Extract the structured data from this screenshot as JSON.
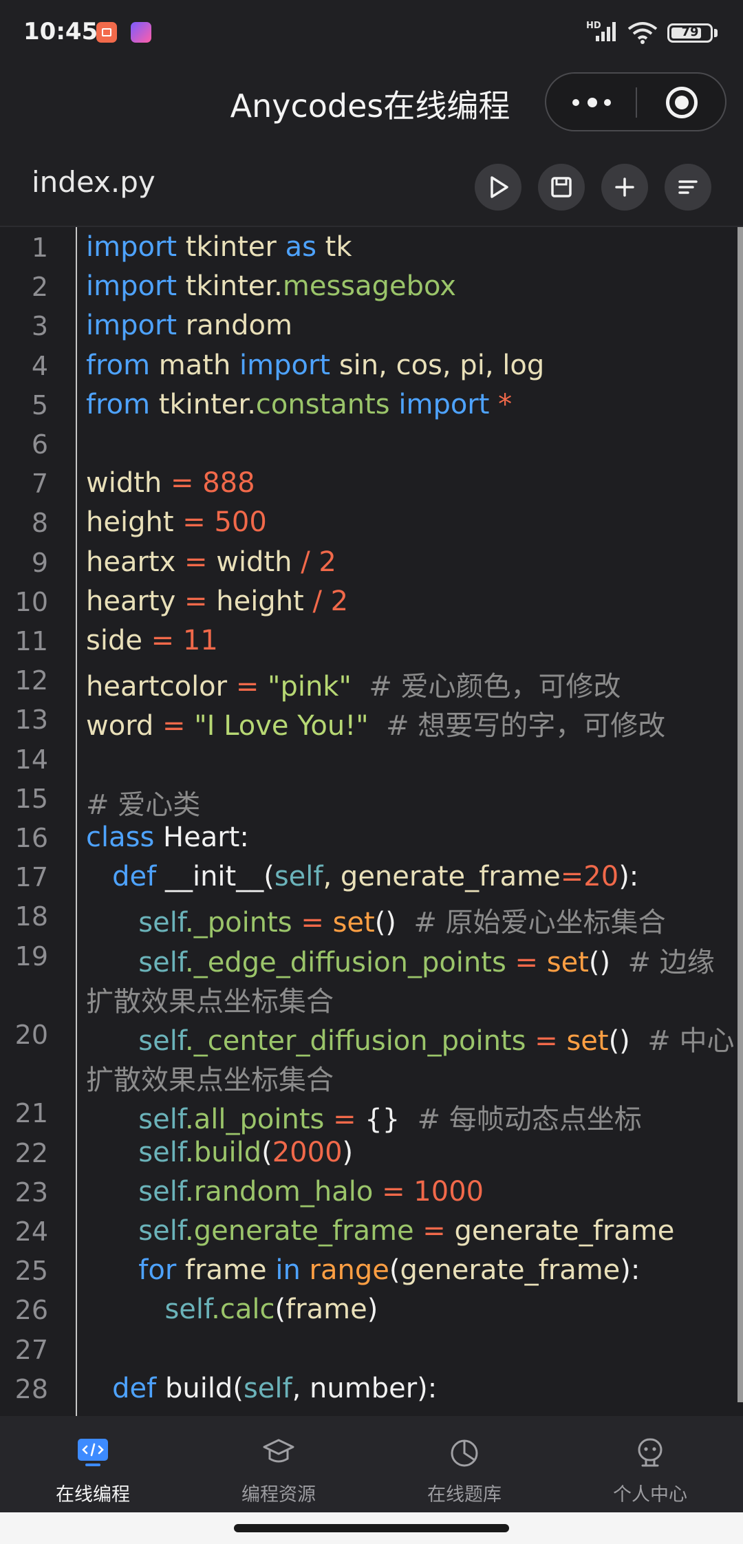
{
  "status": {
    "time": "10:45",
    "hd": "HD",
    "battery": "79",
    "battery_level": 0.79
  },
  "titlebar": {
    "title": "Anycodes在线编程"
  },
  "filebar": {
    "filename": "index.py"
  },
  "editor": {
    "line_numbers": [
      "1",
      "2",
      "3",
      "4",
      "5",
      "6",
      "7",
      "8",
      "9",
      "10",
      "11",
      "12",
      "13",
      "14",
      "15",
      "16",
      "17",
      "18",
      "19",
      "20",
      "21",
      "22",
      "23",
      "24",
      "25",
      "26",
      "27",
      "28"
    ],
    "lines": [
      [
        [
          "kw",
          "import"
        ],
        [
          "pl",
          " tkinter "
        ],
        [
          "kw",
          "as"
        ],
        [
          "pl",
          " tk"
        ]
      ],
      [
        [
          "kw",
          "import"
        ],
        [
          "pl",
          " tkinter."
        ],
        [
          "mod",
          "messagebox"
        ]
      ],
      [
        [
          "kw",
          "import"
        ],
        [
          "pl",
          " random"
        ]
      ],
      [
        [
          "kw",
          "from"
        ],
        [
          "pl",
          " math "
        ],
        [
          "kw",
          "import"
        ],
        [
          "pl",
          " sin, cos, pi, log"
        ]
      ],
      [
        [
          "kw",
          "from"
        ],
        [
          "pl",
          " tkinter."
        ],
        [
          "mod",
          "constants"
        ],
        [
          "pl",
          " "
        ],
        [
          "kw",
          "import"
        ],
        [
          "pl",
          " "
        ],
        [
          "op",
          "*"
        ]
      ],
      [],
      [
        [
          "pl",
          "width "
        ],
        [
          "op",
          "="
        ],
        [
          "pl",
          " "
        ],
        [
          "num",
          "888"
        ]
      ],
      [
        [
          "pl",
          "height "
        ],
        [
          "op",
          "="
        ],
        [
          "pl",
          " "
        ],
        [
          "num",
          "500"
        ]
      ],
      [
        [
          "pl",
          "heartx "
        ],
        [
          "op",
          "="
        ],
        [
          "pl",
          " width "
        ],
        [
          "op",
          "/"
        ],
        [
          "pl",
          " "
        ],
        [
          "num",
          "2"
        ]
      ],
      [
        [
          "pl",
          "hearty "
        ],
        [
          "op",
          "="
        ],
        [
          "pl",
          " height "
        ],
        [
          "op",
          "/"
        ],
        [
          "pl",
          " "
        ],
        [
          "num",
          "2"
        ]
      ],
      [
        [
          "pl",
          "side "
        ],
        [
          "op",
          "="
        ],
        [
          "pl",
          " "
        ],
        [
          "num",
          "11"
        ]
      ],
      [
        [
          "pl",
          "heartcolor "
        ],
        [
          "op",
          "="
        ],
        [
          "pl",
          " "
        ],
        [
          "str",
          "\"pink\""
        ],
        [
          "pl",
          "  "
        ],
        [
          "cm",
          "# 爱心颜色，可修改"
        ]
      ],
      [
        [
          "pl",
          "word "
        ],
        [
          "op",
          "="
        ],
        [
          "pl",
          " "
        ],
        [
          "str",
          "\"I Love You!\""
        ],
        [
          "pl",
          "  "
        ],
        [
          "cm",
          "# 想要写的字，可修改"
        ]
      ],
      [],
      [
        [
          "cm",
          "# 爱心类"
        ]
      ],
      [
        [
          "kw",
          "class"
        ],
        [
          "white",
          " Heart:"
        ]
      ],
      [
        [
          "pl",
          "   "
        ],
        [
          "kw",
          "def"
        ],
        [
          "white",
          " __init__("
        ],
        [
          "self",
          "self"
        ],
        [
          "pl",
          ", generate_frame"
        ],
        [
          "op",
          "="
        ],
        [
          "num",
          "20"
        ],
        [
          "white",
          "):"
        ]
      ],
      [
        [
          "pl",
          "      "
        ],
        [
          "self",
          "self"
        ],
        [
          "attr",
          "._points"
        ],
        [
          "pl",
          " "
        ],
        [
          "op",
          "="
        ],
        [
          "pl",
          " "
        ],
        [
          "fn",
          "set"
        ],
        [
          "white",
          "()"
        ],
        [
          "pl",
          "  "
        ],
        [
          "cm",
          "# 原始爱心坐标集合"
        ]
      ],
      [
        [
          "pl",
          "      "
        ],
        [
          "self",
          "self"
        ],
        [
          "attr",
          "._edge_diffusion_points"
        ],
        [
          "pl",
          " "
        ],
        [
          "op",
          "="
        ],
        [
          "pl",
          " "
        ],
        [
          "fn",
          "set"
        ],
        [
          "white",
          "()"
        ],
        [
          "pl",
          "  "
        ],
        [
          "cm",
          "# 边缘"
        ]
      ],
      [
        [
          "pl",
          "      "
        ],
        [
          "self",
          "self"
        ],
        [
          "attr",
          "._center_diffusion_points"
        ],
        [
          "pl",
          " "
        ],
        [
          "op",
          "="
        ],
        [
          "pl",
          " "
        ],
        [
          "fn",
          "set"
        ],
        [
          "white",
          "()"
        ],
        [
          "pl",
          "  "
        ],
        [
          "cm",
          "# 中心"
        ]
      ],
      [
        [
          "pl",
          "      "
        ],
        [
          "self",
          "self"
        ],
        [
          "attr",
          ".all_points"
        ],
        [
          "pl",
          " "
        ],
        [
          "op",
          "="
        ],
        [
          "pl",
          " "
        ],
        [
          "white",
          "{}"
        ],
        [
          "pl",
          "  "
        ],
        [
          "cm",
          "# 每帧动态点坐标"
        ]
      ],
      [
        [
          "pl",
          "      "
        ],
        [
          "self",
          "self"
        ],
        [
          "attr",
          ".build"
        ],
        [
          "white",
          "("
        ],
        [
          "num",
          "2000"
        ],
        [
          "white",
          ")"
        ]
      ],
      [
        [
          "pl",
          "      "
        ],
        [
          "self",
          "self"
        ],
        [
          "attr",
          ".random_halo"
        ],
        [
          "pl",
          " "
        ],
        [
          "op",
          "="
        ],
        [
          "pl",
          " "
        ],
        [
          "num",
          "1000"
        ]
      ],
      [
        [
          "pl",
          "      "
        ],
        [
          "self",
          "self"
        ],
        [
          "attr",
          ".generate_frame"
        ],
        [
          "pl",
          " "
        ],
        [
          "op",
          "="
        ],
        [
          "pl",
          " generate_frame"
        ]
      ],
      [
        [
          "pl",
          "      "
        ],
        [
          "kw",
          "for"
        ],
        [
          "pl",
          " frame "
        ],
        [
          "kw",
          "in"
        ],
        [
          "pl",
          " "
        ],
        [
          "fn",
          "range"
        ],
        [
          "white",
          "("
        ],
        [
          "pl",
          "generate_frame"
        ],
        [
          "white",
          "):"
        ]
      ],
      [
        [
          "pl",
          "         "
        ],
        [
          "self",
          "self"
        ],
        [
          "attr",
          ".calc"
        ],
        [
          "white",
          "("
        ],
        [
          "pl",
          "frame"
        ],
        [
          "white",
          ")"
        ]
      ],
      [],
      [
        [
          "pl",
          "   "
        ],
        [
          "kw",
          "def"
        ],
        [
          "white",
          " build("
        ],
        [
          "self",
          "self"
        ],
        [
          "white",
          ", number):"
        ]
      ]
    ],
    "wraps": {
      "19": "扩散效果点坐标集合",
      "20": "扩散效果点坐标集合"
    }
  },
  "nav": [
    {
      "label": "在线编程",
      "icon": "code-monitor-icon",
      "active": true
    },
    {
      "label": "编程资源",
      "icon": "graduation-cap-icon",
      "active": false
    },
    {
      "label": "在线题库",
      "icon": "pie-chart-icon",
      "active": false
    },
    {
      "label": "个人中心",
      "icon": "robot-face-icon",
      "active": false
    }
  ],
  "colors": {
    "accent": "#4ea3ff",
    "background": "#1e1e21"
  }
}
